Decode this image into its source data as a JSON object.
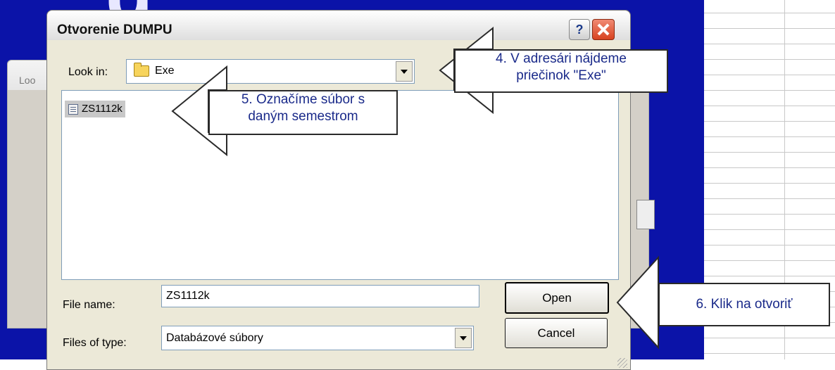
{
  "background": {
    "title_fragment": "g"
  },
  "back_window": {
    "label": "Loo"
  },
  "dialog": {
    "title": "Otvorenie DUMPU",
    "help_glyph": "?",
    "lookin_label": "Look in:",
    "lookin_value": "Exe",
    "files": [
      {
        "name": "ZS1112k"
      }
    ],
    "file_name_label": "File name:",
    "file_name_value": "ZS1112k",
    "files_of_type_label": "Files of type:",
    "files_of_type_value": "Databázové súbory",
    "open_label": "Open",
    "cancel_label": "Cancel"
  },
  "callouts": {
    "step4_line1": "4. V adresári nájdeme",
    "step4_line2": "priečinok \"Exe\"",
    "step5_line1": "5. Označíme súbor s",
    "step5_line2": "daným semestrom",
    "step6": "6. Klik na otvoriť"
  },
  "colors": {
    "app_background": "#0b13a8",
    "callout_text": "#1a2a8a",
    "close_button": "#d8421f"
  },
  "icons": [
    "folder-icon",
    "file-icon",
    "back-arrow-icon",
    "help-icon",
    "close-icon",
    "dropdown-arrow-icon"
  ]
}
